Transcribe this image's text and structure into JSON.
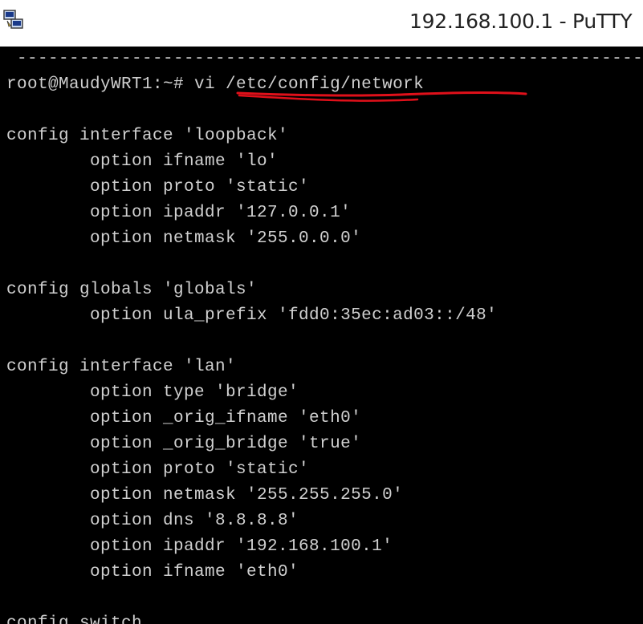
{
  "window": {
    "title": "192.168.100.1 - PuTTY",
    "icon": "putty-icon"
  },
  "terminal": {
    "colors": {
      "background": "#000000",
      "text": "#d0d0d0",
      "annotation": "#e0101a"
    },
    "lines": [
      {
        "text": " -------------------------------------------------------------"
      },
      {
        "text": "root@MaudyWRT1:~# vi /etc/config/network"
      },
      {
        "text": ""
      },
      {
        "text": "config interface 'loopback'"
      },
      {
        "text": "        option ifname 'lo'"
      },
      {
        "text": "        option proto 'static'"
      },
      {
        "text": "        option ipaddr '127.0.0.1'"
      },
      {
        "text": "        option netmask '255.0.0.0'"
      },
      {
        "text": ""
      },
      {
        "text": "config globals 'globals'"
      },
      {
        "text": "        option ula_prefix 'fdd0:35ec:ad03::/48'"
      },
      {
        "text": ""
      },
      {
        "text": "config interface 'lan'"
      },
      {
        "text": "        option type 'bridge'"
      },
      {
        "text": "        option _orig_ifname 'eth0'"
      },
      {
        "text": "        option _orig_bridge 'true'"
      },
      {
        "text": "        option proto 'static'"
      },
      {
        "text": "        option netmask '255.255.255.0'"
      },
      {
        "text": "        option dns '8.8.8.8'"
      },
      {
        "text": "        option ipaddr '192.168.100.1'"
      },
      {
        "text": "        option ifname 'eth0'"
      },
      {
        "text": ""
      },
      {
        "text": "config switch"
      }
    ]
  }
}
